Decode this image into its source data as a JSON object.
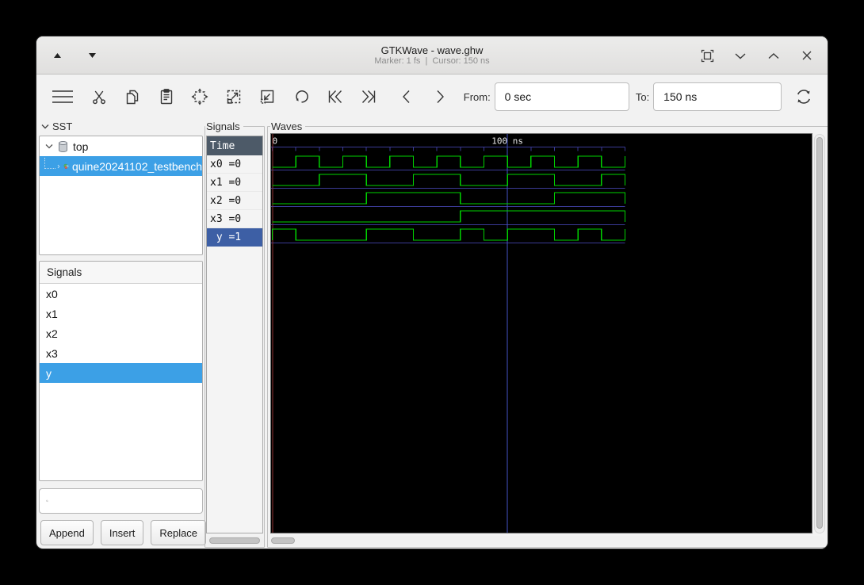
{
  "window": {
    "title": "GTKWave - wave.ghw",
    "subtitle": "Marker: 1 fs  |  Cursor: 150 ns"
  },
  "titlebar_icons": [
    "shade-up-icon",
    "shade-down-icon",
    "fit-window-icon",
    "chevron-down-icon",
    "chevron-up-icon",
    "close-icon"
  ],
  "toolbar": {
    "icons": [
      "menu-icon",
      "cut-icon",
      "copy-icon",
      "paste-icon",
      "zoom-fit-icon",
      "zoom-in-icon",
      "zoom-out-icon",
      "undo-icon",
      "go-to-start-icon",
      "go-to-end-icon",
      "prev-edge-icon",
      "next-edge-icon",
      "reload-icon"
    ],
    "from_label": "From:",
    "from_value": "0 sec",
    "to_label": "To:",
    "to_value": "150 ns"
  },
  "sst": {
    "label": "SST",
    "tree": [
      {
        "label": "top",
        "icon": "database-icon",
        "expanded": true,
        "selected": false
      },
      {
        "label": "quine20241102_testbench",
        "icon": "module-icon",
        "expanded": false,
        "selected": true
      }
    ],
    "signals_panel": {
      "header": "Signals",
      "items": [
        "x0",
        "x1",
        "x2",
        "x3",
        "y"
      ],
      "selected_index": 4
    },
    "search_value": "",
    "buttons": [
      "Append",
      "Insert",
      "Replace"
    ]
  },
  "values_panel": {
    "label": "Signals",
    "header": "Time",
    "rows": [
      {
        "text": "x0 =0",
        "selected": false
      },
      {
        "text": "x1 =0",
        "selected": false
      },
      {
        "text": "x2 =0",
        "selected": false
      },
      {
        "text": "x3 =0",
        "selected": false
      },
      {
        "text": " y =1",
        "selected": true
      }
    ]
  },
  "waves": {
    "label": "Waves"
  },
  "chart_data": {
    "type": "digital-waveform",
    "time_unit": "ns",
    "t_start": 0,
    "t_end": 150,
    "step_ns": 10,
    "timeline_tick_every_ns": 10,
    "timeline_labels": [
      {
        "t": 0,
        "text": "0"
      },
      {
        "t": 100,
        "text": "100 ns"
      }
    ],
    "cursor_ns": 100,
    "marker_ns": 0,
    "signals": [
      {
        "name": "x0",
        "values": [
          0,
          1,
          0,
          1,
          0,
          1,
          0,
          1,
          0,
          1,
          0,
          1,
          0,
          1,
          0
        ]
      },
      {
        "name": "x1",
        "values": [
          0,
          0,
          1,
          1,
          0,
          0,
          1,
          1,
          0,
          0,
          1,
          1,
          0,
          0,
          1
        ]
      },
      {
        "name": "x2",
        "values": [
          0,
          0,
          0,
          0,
          1,
          1,
          1,
          1,
          0,
          0,
          0,
          0,
          1,
          1,
          1
        ]
      },
      {
        "name": "x3",
        "values": [
          0,
          0,
          0,
          0,
          0,
          0,
          0,
          0,
          1,
          1,
          1,
          1,
          1,
          1,
          1
        ]
      },
      {
        "name": "y",
        "values": [
          1,
          0,
          0,
          0,
          1,
          1,
          0,
          0,
          1,
          0,
          1,
          1,
          0,
          1,
          0
        ]
      }
    ]
  },
  "colors": {
    "wave_green": "#00d200",
    "grid_blue": "#3a3a95",
    "cursor_blue": "#4353c6",
    "marker_red": "#8b3232",
    "timeline_text": "#e6e6e6",
    "selection_azure": "#3ca0e6",
    "selection_navy": "#3d5fa5",
    "time_header_bg": "#4d5a68",
    "canvas_black": "#000000"
  }
}
